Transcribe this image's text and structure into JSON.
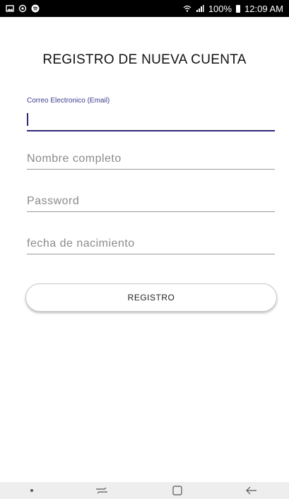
{
  "status_bar": {
    "signal_text": "100%",
    "time": "12:09 AM",
    "left_icons": [
      "gallery-icon",
      "sync-icon",
      "spotify-icon"
    ],
    "right_icons": [
      "wifi-icon",
      "signal-icon",
      "battery-icon"
    ]
  },
  "form": {
    "title": "REGISTRO DE NUEVA CUENTA",
    "email": {
      "label": "Correo Electronico (Email)",
      "value": ""
    },
    "full_name": {
      "placeholder": "Nombre completo"
    },
    "password": {
      "placeholder": "Password"
    },
    "birth_date": {
      "placeholder": "fecha de nacimiento"
    },
    "submit_label": "REGISTRO"
  },
  "nav_bar": {
    "items": [
      "dot-icon",
      "recent-apps-icon",
      "home-icon",
      "back-icon"
    ]
  },
  "colors": {
    "accent": "#2e2a7a",
    "label": "#3b3b8f",
    "placeholder": "#8a8a8a"
  }
}
